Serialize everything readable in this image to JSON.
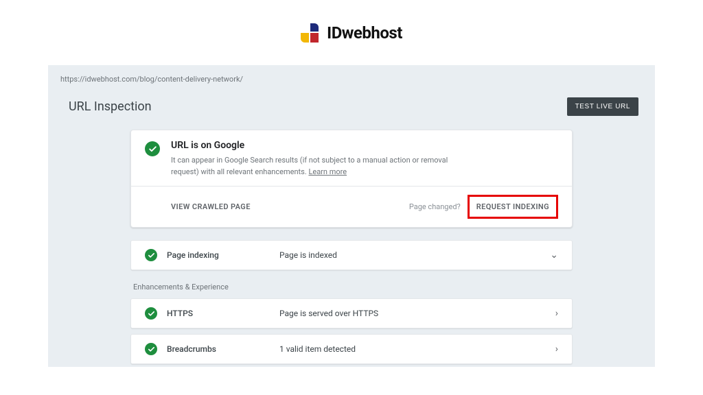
{
  "brand": {
    "name": "IDwebhost"
  },
  "gsc": {
    "url": "https://idwebhost.com/blog/content-delivery-network/",
    "page_title": "URL Inspection",
    "test_live_label": "TEST LIVE URL",
    "status": {
      "title": "URL is on Google",
      "description_prefix": "It can appear in Google Search results (if not subject to a manual action or removal request) with all relevant enhancements. ",
      "learn_more": "Learn more"
    },
    "actions": {
      "view_crawled": "VIEW CRAWLED PAGE",
      "page_changed": "Page changed?",
      "request_indexing": "REQUEST INDEXING"
    },
    "indexing_row": {
      "label": "Page indexing",
      "value": "Page is indexed"
    },
    "enh_heading": "Enhancements & Experience",
    "rows": [
      {
        "label": "HTTPS",
        "value": "Page is served over HTTPS"
      },
      {
        "label": "Breadcrumbs",
        "value": "1 valid item detected"
      }
    ]
  }
}
